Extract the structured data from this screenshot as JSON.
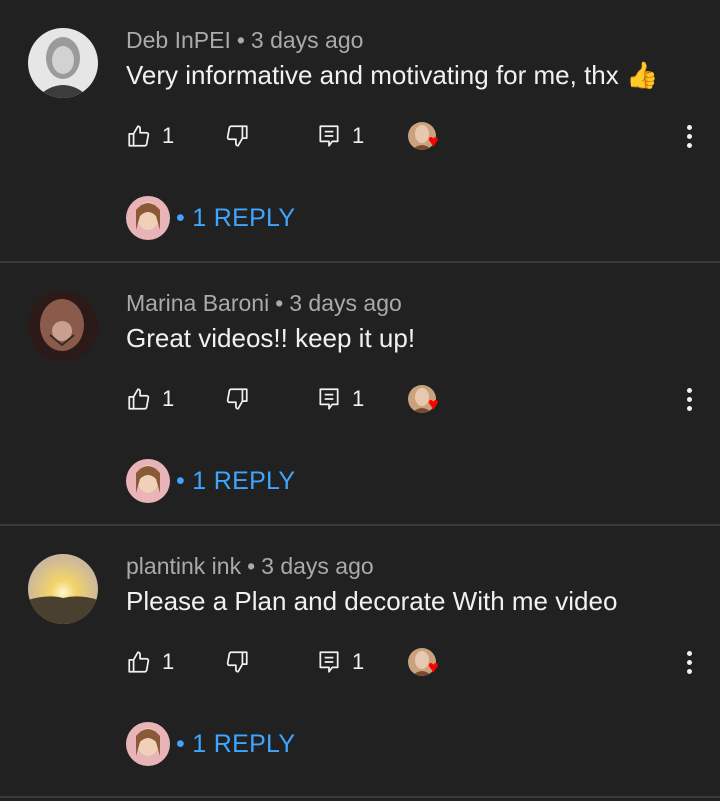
{
  "comments": [
    {
      "author": "Deb InPEI",
      "separator": "•",
      "time": "3 days ago",
      "text": "Very informative and motivating for me, thx 👍",
      "likes": "1",
      "replies_count": "1",
      "replies_label": "• 1 REPLY",
      "avatar_colors": [
        "#8a8a8a",
        "#cfcfcf",
        "#4a4a4a"
      ]
    },
    {
      "author": "Marina Baroni",
      "separator": "•",
      "time": "3 days ago",
      "text": "Great videos!! keep it up!",
      "likes": "1",
      "replies_count": "1",
      "replies_label": "• 1 REPLY",
      "avatar_colors": [
        "#6b3b33",
        "#c9a08f",
        "#2b1a18"
      ]
    },
    {
      "author": "plantink ink",
      "separator": "•",
      "time": "3 days ago",
      "text": "Please a Plan and decorate With me video",
      "likes": "1",
      "replies_count": "1",
      "replies_label": "• 1 REPLY",
      "avatar_colors": [
        "#d8c7a8",
        "#f3d46a",
        "#4a4030"
      ]
    }
  ],
  "icons": {
    "like": "thumb-up-icon",
    "dislike": "thumb-down-icon",
    "reply": "reply-icon",
    "heart": "heart-icon",
    "more": "more-vert-icon"
  },
  "colors": {
    "background": "#212121",
    "reply_link": "#3ea6ff",
    "meta": "#aaaaaa",
    "heart": "#ff0000"
  }
}
